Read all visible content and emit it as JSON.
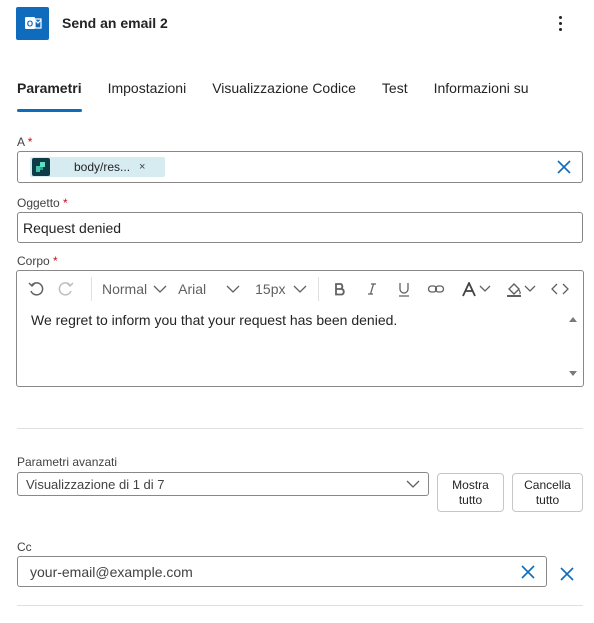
{
  "header": {
    "title": "Send an email 2",
    "icon": "outlook-icon",
    "menu_icon": "more-vertical-icon"
  },
  "tabs": [
    {
      "label": "Parametri",
      "active": true
    },
    {
      "label": "Impostazioni",
      "active": false
    },
    {
      "label": "Visualizzazione Codice",
      "active": false
    },
    {
      "label": "Test",
      "active": false
    },
    {
      "label": "Informazioni su",
      "active": false
    }
  ],
  "to": {
    "label": "A",
    "required_mark": "*",
    "token_label": "body/res...",
    "token_remove": "×"
  },
  "subject": {
    "label": "Oggetto",
    "required_mark": "*",
    "value": "Request denied"
  },
  "body": {
    "label": "Corpo",
    "required_mark": "*",
    "toolbar": {
      "style": "Normal",
      "font": "Arial",
      "size": "15px"
    },
    "text": "We regret to inform you that your request has been denied."
  },
  "advanced": {
    "label": "Parametri avanzati",
    "select_value": "Visualizzazione di 1 di 7",
    "show_all": [
      "Mostra",
      "tutto"
    ],
    "clear_all": [
      "Cancella",
      "tutto"
    ]
  },
  "cc": {
    "label": "Cc",
    "value": "your-email@example.com"
  },
  "colors": {
    "accent": "#0f6cbd",
    "required": "#c50f1f",
    "token_bg": "#d6ecf0"
  }
}
